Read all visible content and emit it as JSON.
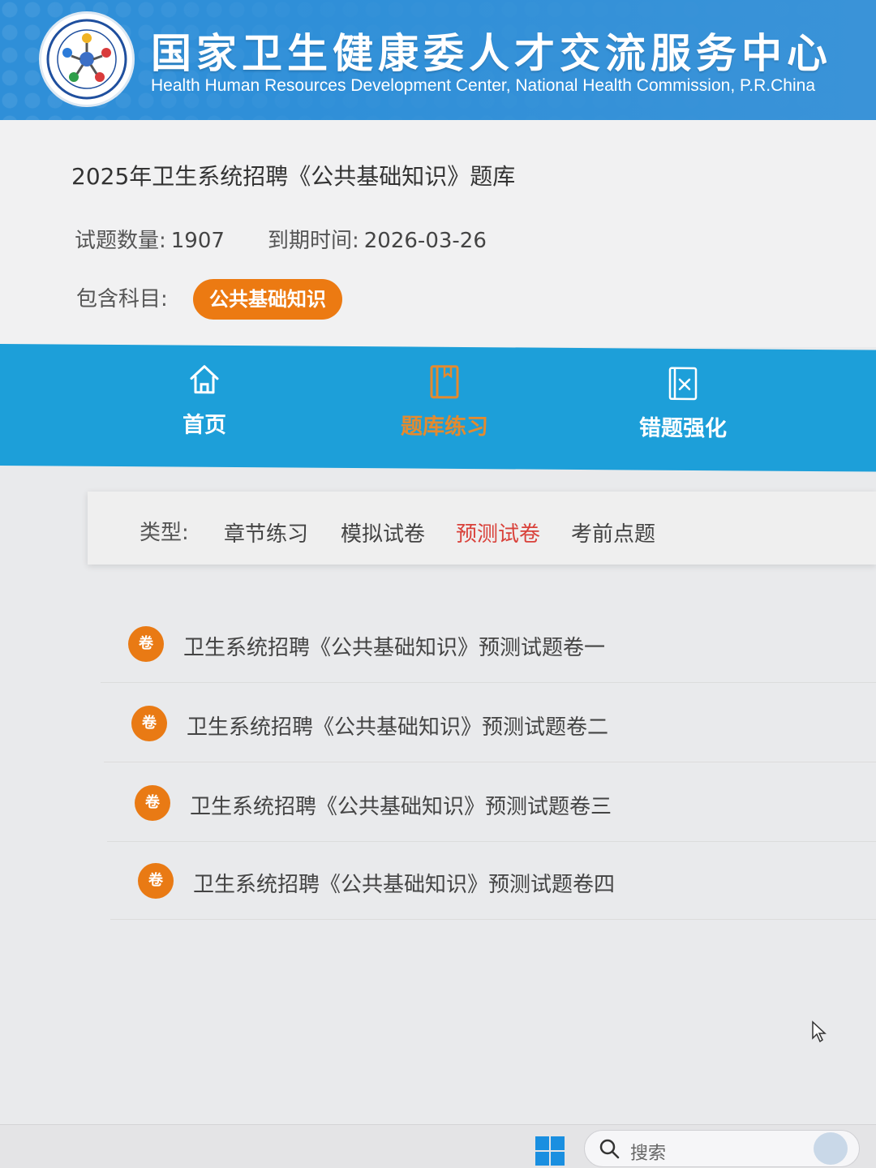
{
  "header": {
    "title": "国家卫生健康委人才交流服务中心",
    "subtitle": "Health Human Resources Development Center, National Health Commission, P.R.China"
  },
  "bank": {
    "title": "2025年卫生系统招聘《公共基础知识》题库",
    "count_label": "试题数量:",
    "count_value": "1907",
    "expiry_label": "到期时间:",
    "expiry_value": "2026-03-26",
    "subjects_label": "包含科目:",
    "subject_tag": "公共基础知识"
  },
  "nav": {
    "items": [
      {
        "label": "首页",
        "icon": "home-icon"
      },
      {
        "label": "题库练习",
        "icon": "book-icon"
      },
      {
        "label": "错题强化",
        "icon": "wrong-question-icon"
      }
    ],
    "active_index": 1,
    "active_color": "#e48a2e"
  },
  "filter": {
    "label": "类型:",
    "tabs": [
      "章节练习",
      "模拟试卷",
      "预测试卷",
      "考前点题"
    ],
    "active_index": 2,
    "active_color": "#d9413a"
  },
  "papers": {
    "badge": "卷",
    "items": [
      "卫生系统招聘《公共基础知识》预测试题卷一",
      "卫生系统招聘《公共基础知识》预测试题卷二",
      "卫生系统招聘《公共基础知识》预测试题卷三",
      "卫生系统招聘《公共基础知识》预测试题卷四"
    ]
  },
  "taskbar": {
    "search_placeholder": "搜索",
    "start_icon": "windows-start-icon",
    "search_icon": "search-icon"
  },
  "colors": {
    "banner": "#2f8fd8",
    "nav_bar": "#1d9fd9",
    "accent_orange": "#ec7a12"
  }
}
